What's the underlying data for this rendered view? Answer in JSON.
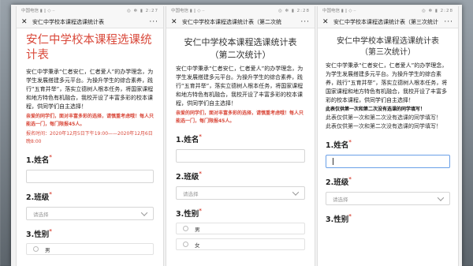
{
  "panel1": {
    "status": {
      "left": "中国电信 ▮ ▯ ◇ ··",
      "right": "◎ ✻ ▮ 2:27"
    },
    "nav_title": "安仁中学校本课程选课统计表",
    "title": "安仁中学校本课程选课统计表",
    "description": "安仁中学秉承“仁者安仁，仁者爱人”的办学理念，为学生发展搭建多元平台。为操升学生的综合素养，践行“五育并举”，落实立德树人根本任务，将国家课程和地方特色有机融合，我校开设了丰富多彩的校本课程，供同学们自主选择！",
    "note_red": "亲爱的同学们，面对丰富多彩的选择，请慎重考虑哦！每人只能选一门，每门限报45人。",
    "time_red": "报名时间：2020年12月5日下午19:00——2020年12月6日晚8:00",
    "fields": {
      "name_label": "姓名",
      "class_label": "班级",
      "class_placeholder": "请选择",
      "gender_label": "性别",
      "gender_option_male": "男"
    },
    "field_numbers": {
      "name": "1.",
      "class": "2.",
      "gender": "3."
    }
  },
  "panel2": {
    "status": {
      "left": "中国电信 ▮ ▯ ◇ ··",
      "right": "◎ ✻ ▮ 2:28"
    },
    "nav_title": "安仁中学校本课程选课统计表（第二次统",
    "title_line1": "安仁中学校本课程选课统计表",
    "title_line2": "（第二次统计）",
    "description": "安仁中学秉承“仁者安仁，仁者爱人”的办学理念，为学生发展搭建多元平台。为操升学生的综合素养，践行“五育并举”，落实立德树人根本任务，将国家课程和地方特色有机融合，我校开设了丰富多彩的校本课程，供同学们自主选择！",
    "note_red": "亲爱的同学们，面对丰富多彩的选择，请慎重考虑哦！每人只能选一门，每门限报45人。",
    "fields": {
      "name_label": "姓名",
      "class_label": "班级",
      "class_placeholder": "请选择",
      "gender_label": "性别",
      "gender_option_male": "男",
      "gender_option_female": "女"
    },
    "field_numbers": {
      "name": "1.",
      "class": "2.",
      "gender": "3."
    }
  },
  "panel3": {
    "status": {
      "left": "中国电信 ▮ ▯ ◇ ··",
      "right": "◎ ✻ ▮ 2:28"
    },
    "nav_title": "安仁中学校本课程选课统计表（第三次统计",
    "title_line1": "安仁中学校本课程选课统计表",
    "title_line2": "（第三次统计）",
    "description": "安仁中学秉承“仁者安仁，仁者爱人”的办学理念，为学生发展搭建多元平台。为操升学生的综合素养，践行“五育并举”，落实立德树人根本任务，将国家课程和地方特色有机融合，我校开设了丰富多彩的校本课程，供同学们自主选择！",
    "notice_bold": "此表仅供第一次和第二次没有选课的同学填写！",
    "notice_plain": "此表仅供第一次和第二次没有选课的同学填写！",
    "notice_plain_repeat": "此表仅供第一次和第二次没有选课的同学填写！",
    "fields": {
      "name_label": "姓名",
      "class_label": "班级",
      "class_placeholder": "请选择",
      "gender_label": "性别"
    },
    "field_numbers": {
      "name": "1.",
      "class": "2.",
      "gender": "3."
    }
  },
  "icons": {
    "close": "close-icon",
    "more": "more-icon",
    "chevron": "chevron-down-icon"
  },
  "colors": {
    "accent_red": "#d9493b",
    "focus_blue": "#6aa0e8"
  }
}
